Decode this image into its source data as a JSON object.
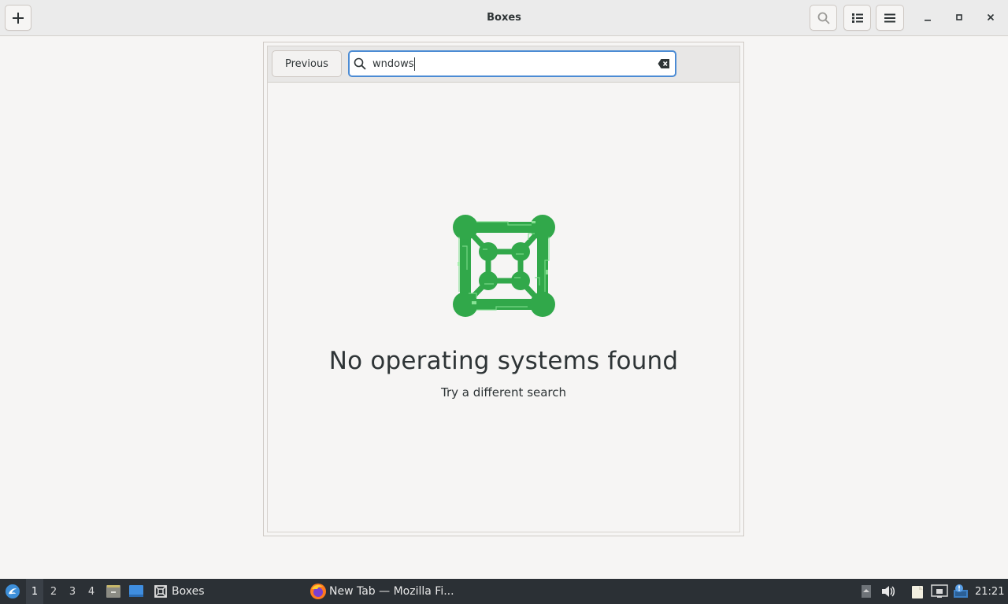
{
  "window": {
    "title": "Boxes",
    "new_button_icon": "plus-icon",
    "search_button_icon": "search-icon",
    "view_button_icon": "list-view-icon",
    "menu_button_icon": "hamburger-menu-icon"
  },
  "dialog": {
    "previous_label": "Previous",
    "search_value": "wndows",
    "empty_title": "No operating systems found",
    "empty_subtitle": "Try a different search",
    "logo_color": "#33b04a"
  },
  "taskbar": {
    "workspaces": [
      "1",
      "2",
      "3",
      "4"
    ],
    "active_workspace": "1",
    "tasks": [
      {
        "label": "Boxes",
        "icon": "boxes-icon"
      },
      {
        "label": "New Tab — Mozilla Fi...",
        "icon": "firefox-icon"
      }
    ],
    "clock": "21:21"
  },
  "colors": {
    "accent": "#4b8bd4",
    "taskbar_bg": "#2b3035"
  }
}
